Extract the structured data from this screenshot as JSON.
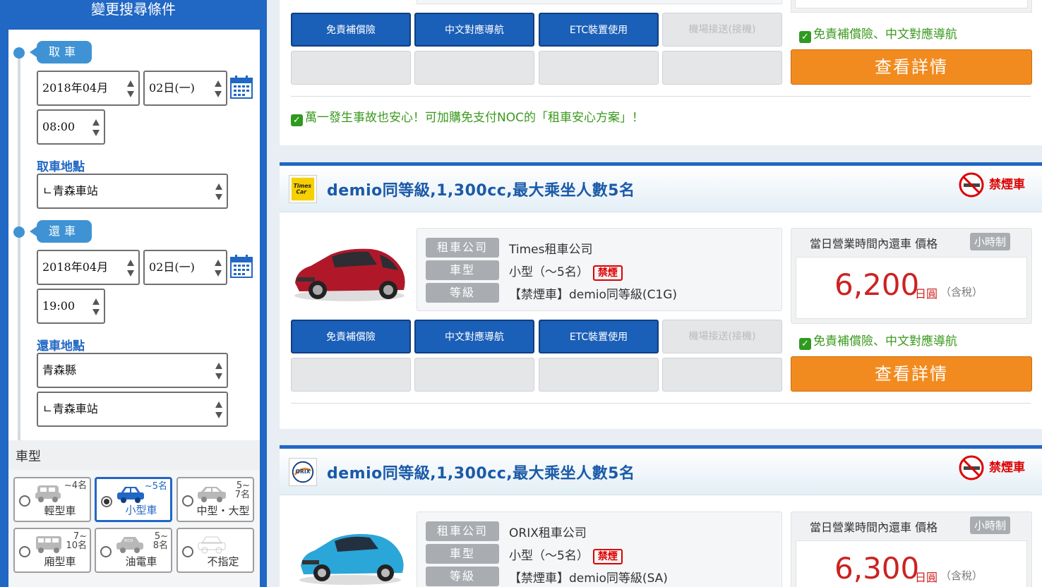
{
  "sidebar": {
    "title": "變更搜尋條件",
    "pickup_label": "取車",
    "pickup_date": "2018年04月",
    "pickup_day": "02日(一)",
    "pickup_time": "08:00",
    "pickup_location_label": "取車地點",
    "pickup_location": "ㄴ青森車站",
    "return_label": "還車",
    "return_date": "2018年04月",
    "return_day": "02日(一)",
    "return_time": "19:00",
    "return_location_label": "還車地點",
    "return_prefecture": "青森縣",
    "return_location": "ㄴ青森車站",
    "car_type_label": "車型",
    "car_types": [
      {
        "name": "輕型車",
        "cap": "~4名"
      },
      {
        "name": "小型車",
        "cap": "~5名"
      },
      {
        "name": "中型・大型",
        "cap": "5~\n7名"
      },
      {
        "name": "廂型車",
        "cap": "7~\n10名"
      },
      {
        "name": "油電車",
        "cap": "5~\n8名"
      },
      {
        "name": "不指定",
        "cap": ""
      }
    ],
    "selected_car_type": "小型車"
  },
  "top_card": {
    "options": [
      "免責補償險",
      "中文對應導航",
      "ETC裝置使用",
      "機場接送(接機)"
    ],
    "included_note": "免責補償險、中文對應導航",
    "detail_button": "查看詳情",
    "noc_note": "萬一發生事故也安心！可加購免支付NOC的「租車安心方案」！"
  },
  "cards": [
    {
      "title": "demio同等級,1,300cc,最大乘坐人數5名",
      "no_smoking": "禁煙車",
      "logo": "Times Car",
      "company_key": "租車公司",
      "company": "Times租車公司",
      "type_key": "車型",
      "type": "小型（～5名）",
      "type_tag": "禁煙",
      "grade_key": "等級",
      "grade": "【禁煙車】demio同等級(C1G)",
      "price_caption": "當日營業時間內還車 價格",
      "hour_badge": "小時制",
      "price": "6,200",
      "price_unit": "日圓",
      "price_tax": "（含稅）",
      "car_color": "#b0182a",
      "options": [
        "免責補償險",
        "中文對應導航",
        "ETC裝置使用",
        "機場接送(接機)"
      ],
      "included_note": "免責補償險、中文對應導航",
      "detail_button": "查看詳情"
    },
    {
      "title": "demio同等級,1,300cc,最大乘坐人數5名",
      "no_smoking": "禁煙車",
      "logo": "ORIX",
      "company_key": "租車公司",
      "company": "ORIX租車公司",
      "type_key": "車型",
      "type": "小型（～5名）",
      "type_tag": "禁煙",
      "grade_key": "等級",
      "grade": "【禁煙車】demio同等級(SA)",
      "price_caption": "當日營業時間內還車 價格",
      "hour_badge": "小時制",
      "price": "6,300",
      "price_unit": "日圓",
      "price_tax": "（含稅）",
      "car_color": "#2aa6d8"
    }
  ],
  "colors": {
    "brand_blue": "#2167c4",
    "price_red": "#cc2222",
    "cta_orange": "#f28b1f",
    "note_green": "#3a9a1e"
  }
}
